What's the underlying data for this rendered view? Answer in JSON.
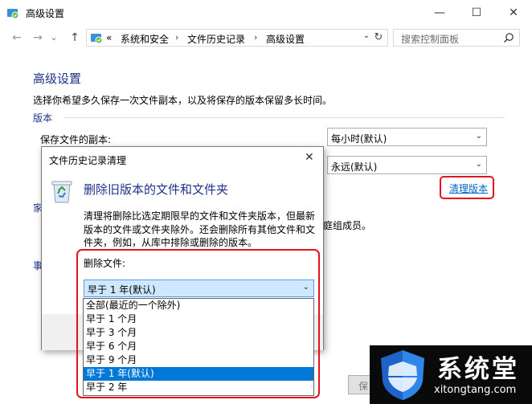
{
  "window": {
    "title": "高级设置",
    "minimize_glyph": "—",
    "maximize_glyph": "☐",
    "close_glyph": "✕"
  },
  "nav": {
    "back_glyph": "←",
    "forward_glyph": "→",
    "history_glyph": "⌄",
    "up_glyph": "↑",
    "overflow": "«",
    "breadcrumbs": [
      "系统和安全",
      "文件历史记录",
      "高级设置"
    ],
    "separator": "›",
    "dropdown_glyph": "⌄",
    "refresh_glyph": "↻"
  },
  "search": {
    "placeholder": "搜索控制面板"
  },
  "page": {
    "heading": "高级设置",
    "description": "选择你希望多久保存一次文件副本，以及将保存的版本保留多长时间。",
    "section_versions": "版本",
    "save_copies_label": "保存文件的副本:",
    "save_copies_value": "每小时(默认)",
    "keep_versions_value": "永远(默认)",
    "cleanup_link": "清理版本",
    "family_fragment": "庭组成员。",
    "left_fragment_1": "家",
    "left_fragment_2": "事",
    "bottom_button_fragment": "保"
  },
  "dialog": {
    "title": "文件历史记录清理",
    "close_glyph": "✕",
    "heading": "删除旧版本的文件和文件夹",
    "description": "清理将删除比选定期限早的文件和文件夹版本，但最新版本的文件或文件夹除外。还会删除所有其他文件和文件夹，例如，从库中排除或删除的版本。",
    "delete_files_label": "删除文件:",
    "selected_value": "早于 1 年(默认)",
    "options": [
      "全部(最近的一个除外)",
      "早于 1 个月",
      "早于 3 个月",
      "早于 6 个月",
      "早于 9 个月",
      "早于 1 年(默认)",
      "早于 2 年"
    ],
    "selected_index": 5
  },
  "watermark": {
    "title": "系统堂",
    "url": "xitongtang.com"
  },
  "colors": {
    "accent": "#1e3287",
    "link": "#0066cc",
    "highlight": "#e0141e",
    "selection": "#0078d7"
  }
}
